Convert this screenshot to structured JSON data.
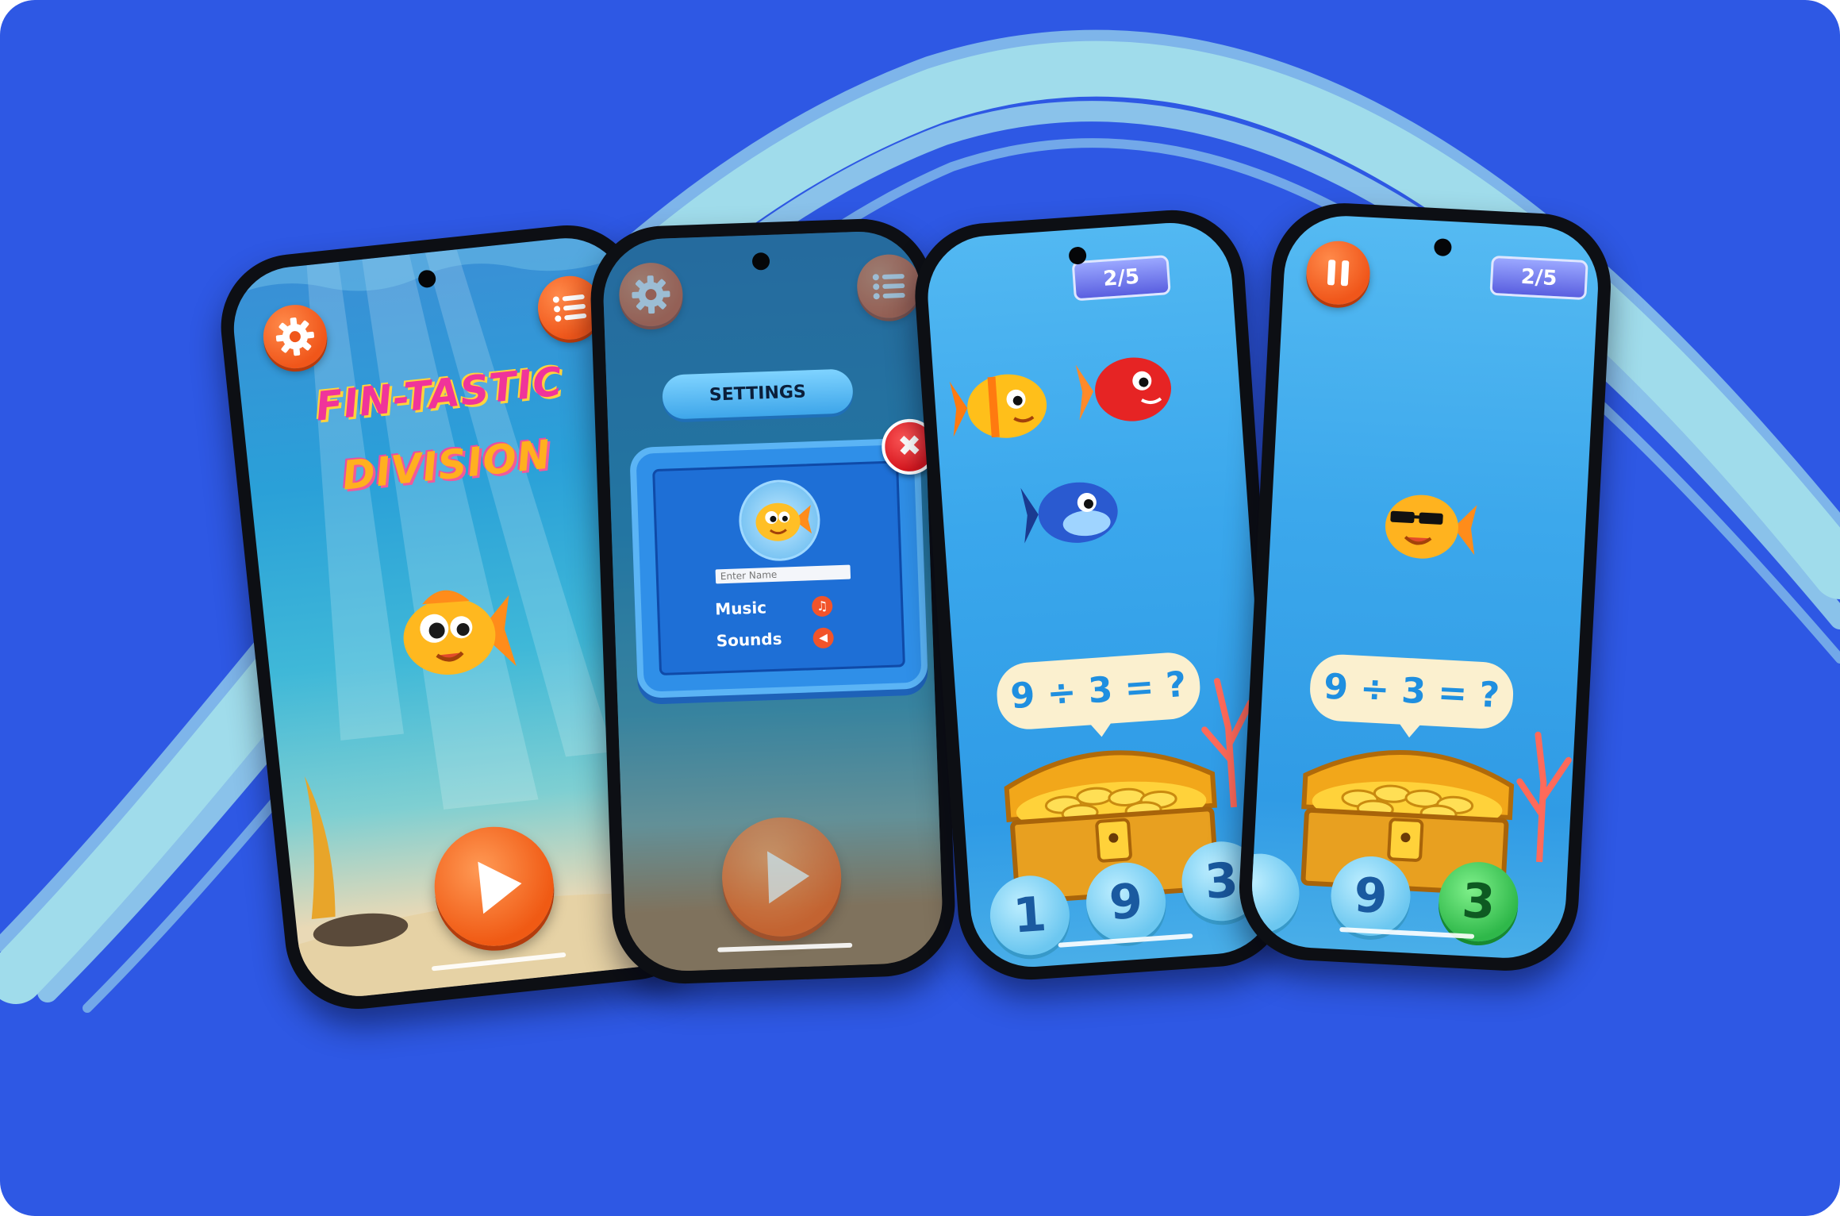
{
  "colors": {
    "background": "#2e58e4",
    "arc": "#a7e4ec",
    "accent_orange": "#f0561a",
    "question_text": "#1f8fe0",
    "correct_answer": "#2fb84a"
  },
  "screen_home": {
    "title_line1": "FIN-TASTIC",
    "title_line2": "DIVISION",
    "settings_icon": "gear-icon",
    "menu_icon": "list-icon",
    "play_icon": "play-icon"
  },
  "screen_settings": {
    "header": "SETTINGS",
    "name_placeholder": "Enter Name",
    "music_label": "Music",
    "sounds_label": "Sounds",
    "close_icon": "close-icon"
  },
  "screen_question": {
    "score": "2/5",
    "question": "9 ÷ 3 = ?",
    "answers": [
      "1",
      "9",
      "3"
    ]
  },
  "screen_result": {
    "score": "2/5",
    "question": "9 ÷ 3 = ?",
    "answers": [
      "9",
      "3"
    ],
    "correct_answer": "3",
    "pause_icon": "pause-icon"
  }
}
